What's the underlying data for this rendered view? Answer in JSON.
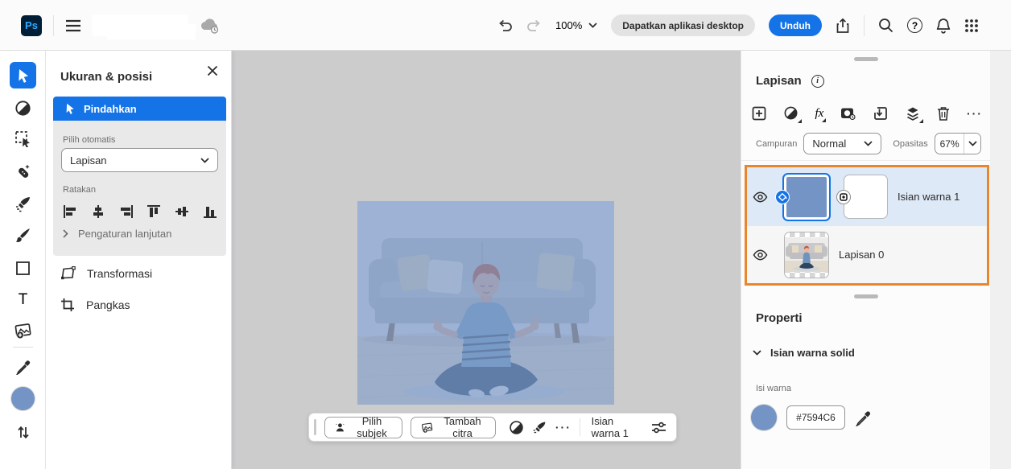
{
  "topbar": {
    "logo": "Ps",
    "zoom_level": "100%",
    "get_desktop_app_label": "Dapatkan aplikasi desktop",
    "download_label": "Unduh"
  },
  "tool_options_panel": {
    "title": "Ukuran & posisi",
    "move_button_label": "Pindahkan",
    "auto_select_label": "Pilih otomatis",
    "auto_select_value": "Lapisan",
    "align_label": "Ratakan",
    "advanced_settings_label": "Pengaturan lanjutan",
    "transform_label": "Transformasi",
    "crop_label": "Pangkas"
  },
  "layers_panel": {
    "title": "Lapisan",
    "blend_label": "Campuran",
    "blend_value": "Normal",
    "opacity_label": "Opasitas",
    "opacity_value": "67%",
    "rows": [
      {
        "name": "Isian warna 1",
        "selected": true
      },
      {
        "name": "Lapisan 0",
        "selected": false
      }
    ]
  },
  "properties_panel": {
    "title": "Properti",
    "section_label": "Isian warna solid",
    "fill_label": "Isi warna",
    "fill_hex": "#7594C6"
  },
  "taskbar": {
    "select_subject_label": "Pilih subjek",
    "add_image_label": "Tambah citra",
    "active_layer_label": "Isian warna 1"
  },
  "icons": {
    "fx_glyph": "fx",
    "type_tool_glyph": "T",
    "help_glyph": "?",
    "more_glyph": "···"
  },
  "colors": {
    "accent_blue": "#1473E6",
    "fill_color": "#7594C6",
    "highlight_border_orange": "#E8862D",
    "selected_layer_row": "#DEE9F7",
    "logo_bg": "#001E36",
    "logo_text": "#31A8FF"
  }
}
